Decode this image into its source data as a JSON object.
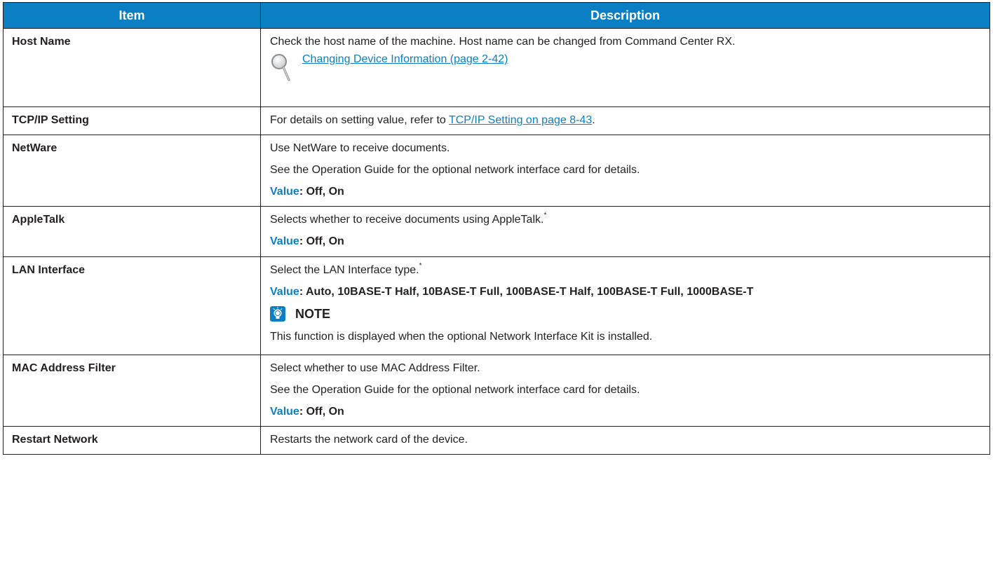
{
  "header": {
    "item": "Item",
    "description": "Description"
  },
  "rows": [
    {
      "item": "Host Name",
      "desc_line1": "Check the host name of the machine. Host name can be changed from Command Center RX.",
      "link": "Changing Device Information (page 2-42)"
    },
    {
      "item": "TCP/IP Setting",
      "desc_prefix": "For details on setting value, refer to ",
      "link": "TCP/IP Setting on page 8-43",
      "desc_suffix": "."
    },
    {
      "item": "NetWare",
      "line1": "Use NetWare to receive documents.",
      "line2": "See the Operation Guide for the optional network interface card for details.",
      "value_label": "Value",
      "value_text": ": Off, On"
    },
    {
      "item": "AppleTalk",
      "line1": "Selects whether to receive documents using AppleTalk.",
      "footnote": "*",
      "value_label": "Value",
      "value_text": ": Off, On"
    },
    {
      "item": "LAN Interface",
      "line1": "Select the LAN Interface type.",
      "footnote": "*",
      "value_label": "Value",
      "value_text": ": Auto, 10BASE-T Half, 10BASE-T Full, 100BASE-T Half, 100BASE-T Full, 1000BASE-T",
      "note_title": "NOTE",
      "note_text": "This function is displayed when the optional Network Interface Kit is installed."
    },
    {
      "item": "MAC Address Filter",
      "line1": "Select whether to use MAC Address Filter.",
      "line2": "See the Operation Guide for the optional network interface card for details.",
      "value_label": "Value",
      "value_text": ": Off, On"
    },
    {
      "item": "Restart Network",
      "line1": "Restarts the network card of the device."
    }
  ],
  "colors": {
    "header_bg": "#0b7fc3",
    "accent": "#0b7fc3",
    "text": "#231f20"
  },
  "icons": [
    "magnifier-icon",
    "note-icon"
  ]
}
